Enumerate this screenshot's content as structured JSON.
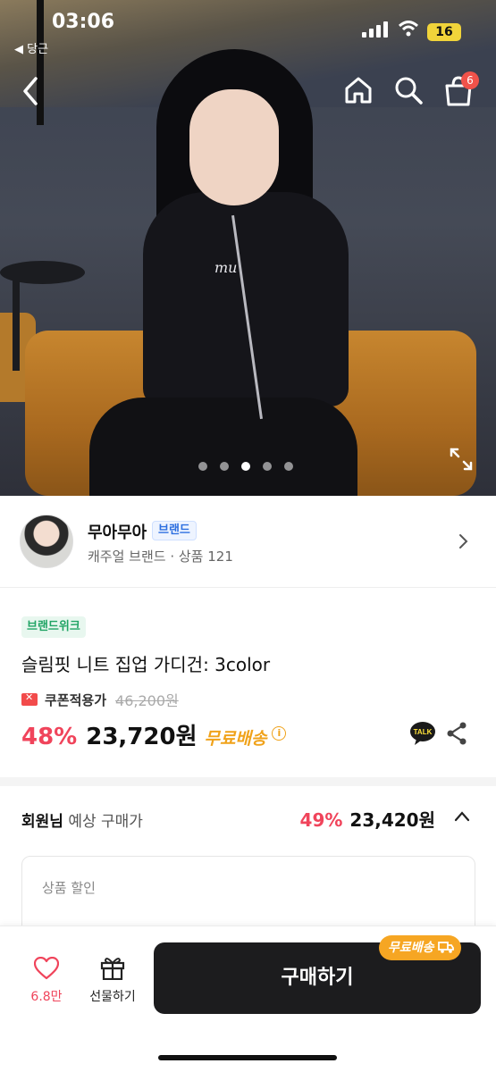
{
  "status": {
    "time": "03:06",
    "back_app": "◀ 당근",
    "battery": "16"
  },
  "nav": {
    "cart_badge": "6"
  },
  "gallery": {
    "dots": 5,
    "active_index": 2
  },
  "brand": {
    "name": "무아무아",
    "chip": "브랜드",
    "sub": "캐주얼 브랜드 · 상품 121"
  },
  "product": {
    "badge": "브랜드위크",
    "title": "슬림핏 니트 집업 가디건: 3color",
    "coupon_label": "쿠폰적용가",
    "original_price": "46,200원",
    "discount": "48%",
    "price": "23,720원",
    "free_shipping": "무료배송",
    "talk_label": "TALK"
  },
  "member": {
    "label_bold": "회원님",
    "label_rest": " 예상 구매가",
    "discount": "49%",
    "price": "23,420원",
    "detail_label": "상품 할인"
  },
  "bottom": {
    "like_count": "6.8만",
    "gift_label": "선물하기",
    "buy_label": "구매하기",
    "ship_bubble": "무료배송"
  },
  "colors": {
    "accent_red": "#f0445b",
    "ship_orange": "#f6a623",
    "brand_blue": "#2d6fe0",
    "week_green": "#21a465"
  }
}
